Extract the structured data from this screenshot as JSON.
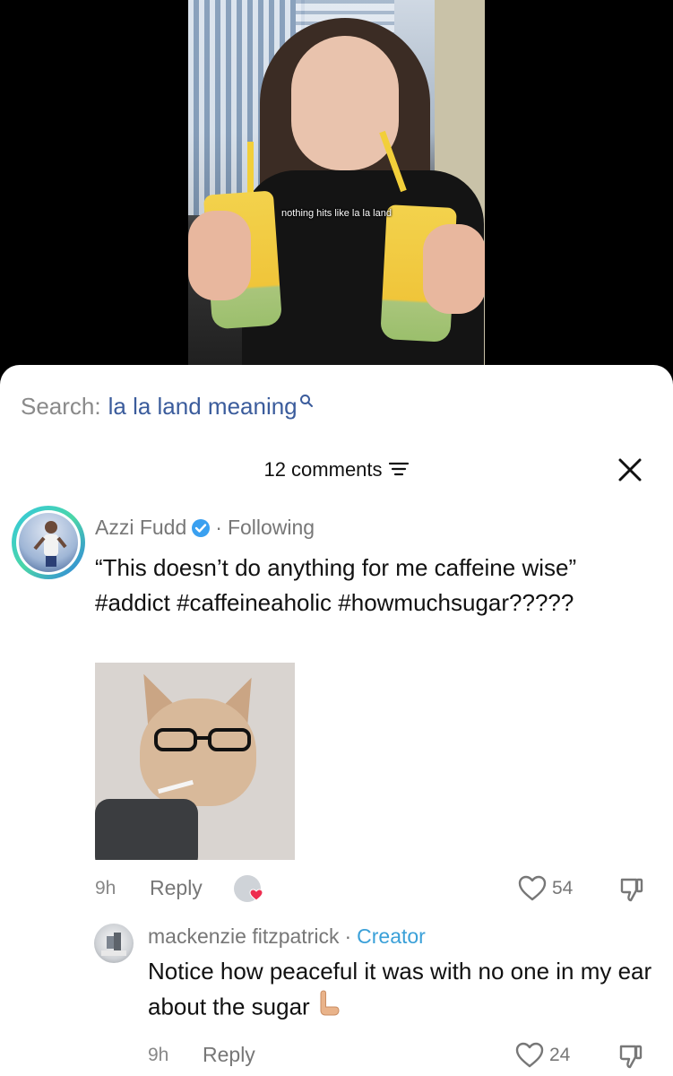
{
  "video": {
    "caption": "nothing hits like la la land"
  },
  "search": {
    "label": "Search:",
    "term": "la la land meaning"
  },
  "comments_header": {
    "count_label": "12 comments"
  },
  "comments": [
    {
      "username": "Azzi Fudd",
      "verified": true,
      "relation": "Following",
      "text": "“This doesn’t do anything for me caffeine wise” #addict #caffeineaholic #howmuchsugar?????",
      "time": "9h",
      "reply_label": "Reply",
      "likes": "54",
      "replies": [
        {
          "username": "mackenzie fitzpatrick",
          "role": "Creator",
          "text": "Notice how peaceful it was with no one in my ear about the sugar",
          "time": "9h",
          "reply_label": "Reply",
          "likes": "24"
        }
      ]
    }
  ],
  "icons": {
    "search": "search-icon",
    "filter": "filter-icon",
    "close": "close-icon",
    "heart": "heart-icon",
    "dislike": "dislike-icon",
    "verified": "verified-badge-icon"
  },
  "colors": {
    "search_term": "#3b5c9c",
    "creator": "#3aa0d8",
    "verified": "#3aa0f0",
    "muted": "#777777"
  }
}
